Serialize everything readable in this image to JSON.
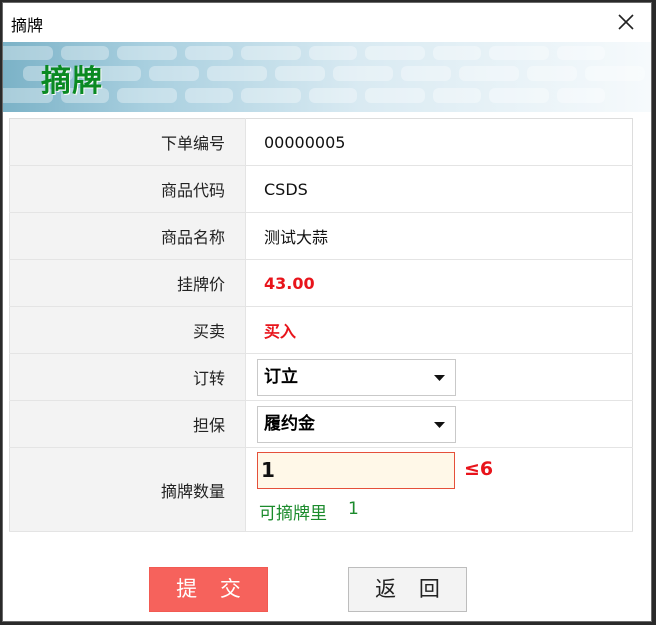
{
  "window": {
    "title": "摘牌"
  },
  "banner": {
    "title": "摘牌"
  },
  "form": {
    "rows": [
      {
        "label": "下单编号",
        "value": "00000005"
      },
      {
        "label": "商品代码",
        "value": "CSDS"
      },
      {
        "label": "商品名称",
        "value": "测试大蒜"
      },
      {
        "label": "挂牌价",
        "value": "43.00"
      },
      {
        "label": "买卖",
        "value": "买入"
      }
    ],
    "order_type": {
      "label": "订转",
      "selected": "订立"
    },
    "guarantee": {
      "label": "担保",
      "selected": "履约金"
    },
    "quantity": {
      "label": "摘牌数量",
      "value": "1",
      "limit": "≤6",
      "available_label": "可摘牌里",
      "available_value": "1"
    }
  },
  "buttons": {
    "submit": "提 交",
    "back": "返 回"
  },
  "colors": {
    "accent_red": "#e8141b",
    "submit_bg": "#f6625c",
    "green_text": "#1b8b2c"
  }
}
